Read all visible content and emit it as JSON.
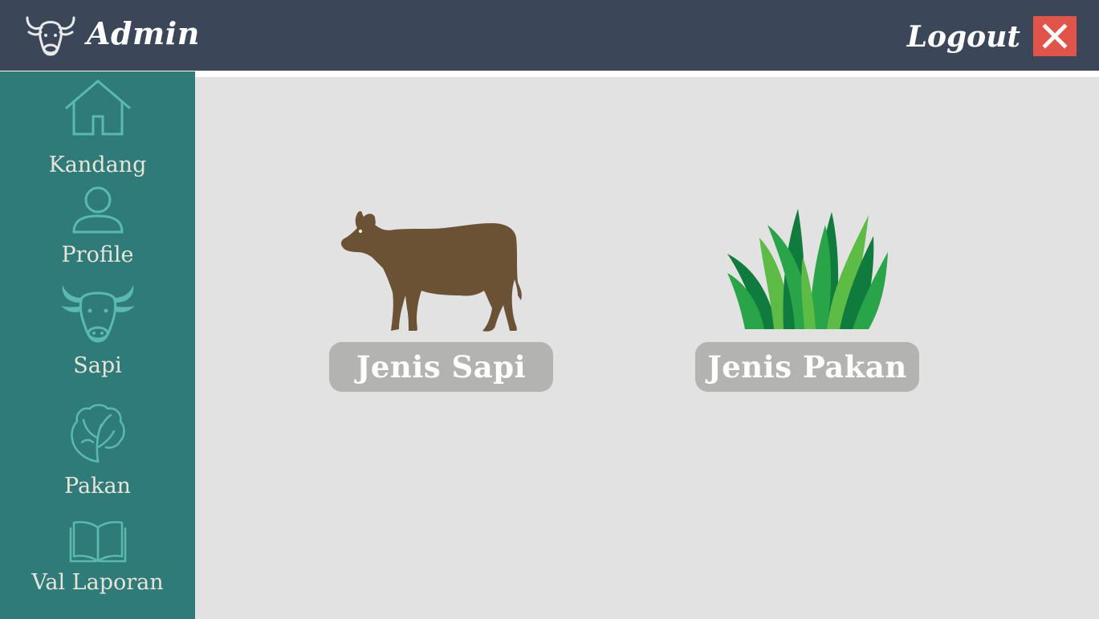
{
  "header": {
    "title": "Admin",
    "logout_label": "Logout",
    "logo_icon": "cow-head-icon",
    "close_icon": "close-icon"
  },
  "sidebar": {
    "items": [
      {
        "label": "Kandang",
        "icon": "house-icon"
      },
      {
        "label": "Profile",
        "icon": "user-icon"
      },
      {
        "label": "Sapi",
        "icon": "cow-head-icon"
      },
      {
        "label": "Pakan",
        "icon": "lettuce-icon"
      },
      {
        "label": "Val Laporan",
        "icon": "open-book-icon"
      }
    ]
  },
  "main": {
    "cards": [
      {
        "label": "Jenis Sapi",
        "icon": "cow-icon"
      },
      {
        "label": "Jenis Pakan",
        "icon": "grass-icon"
      }
    ]
  },
  "colors": {
    "header_bg": "#3b4759",
    "sidebar_bg": "#2f7b79",
    "main_bg": "#e2e2e2",
    "close_button": "#e05449",
    "card_button": "#b3b3b2",
    "cow": "#6b5235",
    "grass_dark": "#0f7b3d",
    "grass_mid": "#2aa449",
    "grass_light": "#5cbc45"
  }
}
